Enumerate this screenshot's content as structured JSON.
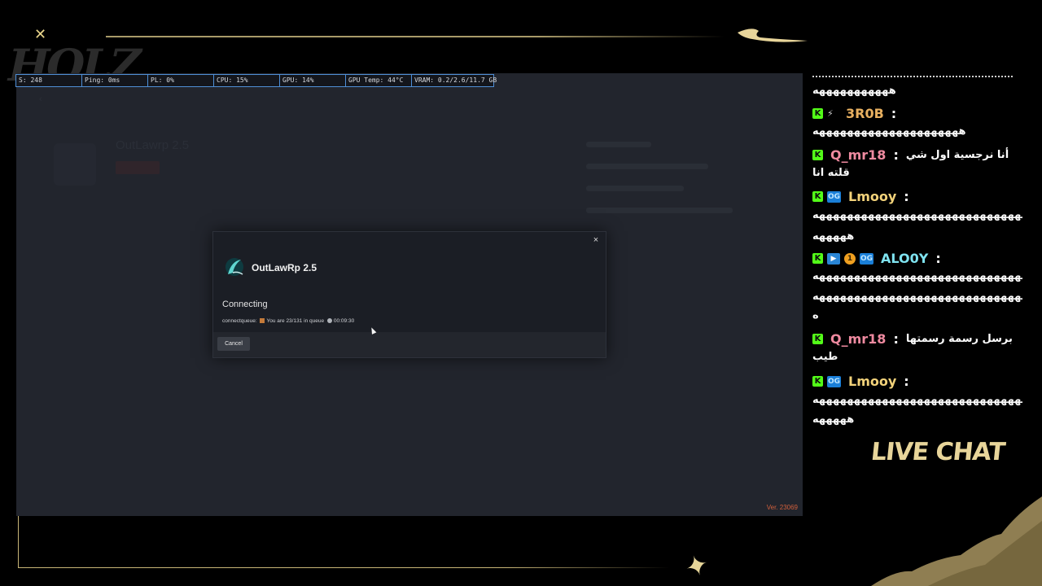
{
  "overlay": {
    "brand_logo_text": "HOLZ",
    "live_chat_label": "LIVE CHAT",
    "accent_color": "#c8b577"
  },
  "stats_bar": [
    {
      "key": "fps",
      "label": "S: 248"
    },
    {
      "key": "ping",
      "label": "Ping: 0ms"
    },
    {
      "key": "pl",
      "label": "PL: 0%"
    },
    {
      "key": "cpu",
      "label": "CPU: 15%"
    },
    {
      "key": "gpu",
      "label": "GPU: 14%"
    },
    {
      "key": "gpu_temp",
      "label": "GPU Temp: 44°C"
    },
    {
      "key": "vram",
      "label": "VRAM: 0.2/2.6/11.7 GB"
    }
  ],
  "game": {
    "background_server_title": "OutLawrp 2.5",
    "version": "Ver. 23069"
  },
  "modal": {
    "title": "OutLawRp 2.5",
    "status": "Connecting",
    "queue_prefix": "connectqueue:",
    "queue_text": "You are 23/131 in queue",
    "queue_time": "00:09:30",
    "cancel_label": "Cancel",
    "close_glyph": "×"
  },
  "chat": [
    {
      "type": "text",
      "text": "هههههههههههه"
    },
    {
      "type": "head",
      "user": "3R0B",
      "badges": [
        "kick",
        "bot"
      ],
      "color": "#e8b060"
    },
    {
      "type": "text",
      "text": "هههههههههههههههههههههه"
    },
    {
      "type": "head_ar",
      "user": "Q_mr18",
      "badges": [
        "kick"
      ],
      "color": "#ef8aa0",
      "text": "أنا نرجسية اول شي"
    },
    {
      "type": "text_ar",
      "text": "قلته انا"
    },
    {
      "type": "head",
      "user": "Lmooy",
      "badges": [
        "kick",
        "og"
      ],
      "color": "#f2d27a"
    },
    {
      "type": "text",
      "text": "هههههههههههههههههههههههههههههههه"
    },
    {
      "type": "text",
      "text": "هههههه"
    },
    {
      "type": "head",
      "user": "ALO0Y",
      "badges": [
        "kick",
        "flag",
        "one",
        "og"
      ],
      "color": "#7fe3f0"
    },
    {
      "type": "text",
      "text": "هههههههههههههههههههههههههههههههه"
    },
    {
      "type": "text",
      "text": "هههههههههههههههههههههههههههههههه"
    },
    {
      "type": "text",
      "text": "ه"
    },
    {
      "type": "head_ar",
      "user": "Q_mr18",
      "badges": [
        "kick"
      ],
      "color": "#ef8aa0",
      "text": "برسل رسمة رسمتها"
    },
    {
      "type": "text_ar",
      "text": "طيب"
    },
    {
      "type": "head",
      "user": "Lmooy",
      "badges": [
        "kick",
        "og"
      ],
      "color": "#f2d27a"
    },
    {
      "type": "text",
      "text": "هههههههههههههههههههههههههههههههه"
    },
    {
      "type": "text",
      "text": "هههههه"
    }
  ]
}
